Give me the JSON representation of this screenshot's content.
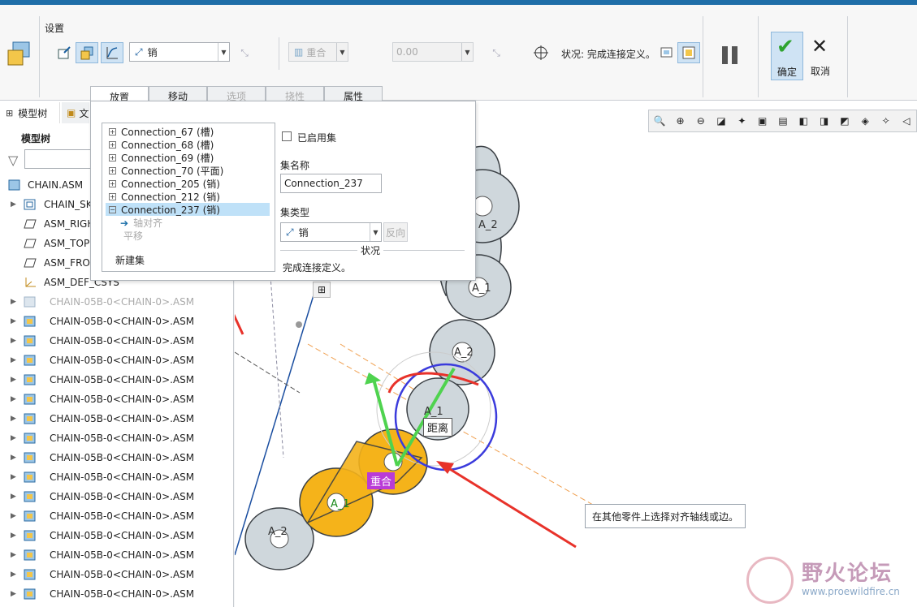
{
  "ribbon": {
    "group_label": "设置",
    "constraint_type": "销",
    "coincident_label": "重合",
    "offset_value": "0.00",
    "status_text": "状况: 完成连接定义。",
    "ok_label": "确定",
    "cancel_label": "取消"
  },
  "tabs": [
    {
      "label": "放置",
      "state": "active"
    },
    {
      "label": "移动",
      "state": "normal"
    },
    {
      "label": "选项",
      "state": "disabled"
    },
    {
      "label": "挠性",
      "state": "disabled"
    },
    {
      "label": "属性",
      "state": "normal"
    }
  ],
  "tree_tabs": {
    "model_tree": "模型树",
    "files": "文"
  },
  "tree": {
    "header": "模型树",
    "items": [
      {
        "label": "CHAIN.ASM",
        "type": "asm-root",
        "expand": false
      },
      {
        "label": "CHAIN_SK",
        "type": "skeleton",
        "expand": true
      },
      {
        "label": "ASM_RIGH",
        "type": "plane",
        "expand": false
      },
      {
        "label": "ASM_TOP",
        "type": "plane",
        "expand": false
      },
      {
        "label": "ASM_FRO",
        "type": "plane",
        "expand": false
      },
      {
        "label": "ASM_DEF_CSYS",
        "type": "csys",
        "expand": false
      },
      {
        "label": "CHAIN-05B-0<CHAIN-0>.ASM",
        "type": "sub-dim",
        "expand": true
      },
      {
        "label": "CHAIN-05B-0<CHAIN-0>.ASM",
        "type": "sub",
        "expand": true
      },
      {
        "label": "CHAIN-05B-0<CHAIN-0>.ASM",
        "type": "sub",
        "expand": true
      },
      {
        "label": "CHAIN-05B-0<CHAIN-0>.ASM",
        "type": "sub",
        "expand": true
      },
      {
        "label": "CHAIN-05B-0<CHAIN-0>.ASM",
        "type": "sub",
        "expand": true
      },
      {
        "label": "CHAIN-05B-0<CHAIN-0>.ASM",
        "type": "sub",
        "expand": true
      },
      {
        "label": "CHAIN-05B-0<CHAIN-0>.ASM",
        "type": "sub",
        "expand": true
      },
      {
        "label": "CHAIN-05B-0<CHAIN-0>.ASM",
        "type": "sub",
        "expand": true
      },
      {
        "label": "CHAIN-05B-0<CHAIN-0>.ASM",
        "type": "sub",
        "expand": true
      },
      {
        "label": "CHAIN-05B-0<CHAIN-0>.ASM",
        "type": "sub",
        "expand": true
      },
      {
        "label": "CHAIN-05B-0<CHAIN-0>.ASM",
        "type": "sub",
        "expand": true
      },
      {
        "label": "CHAIN-05B-0<CHAIN-0>.ASM",
        "type": "sub",
        "expand": true
      },
      {
        "label": "CHAIN-05B-0<CHAIN-0>.ASM",
        "type": "sub",
        "expand": true
      },
      {
        "label": "CHAIN-05B-0<CHAIN-0>.ASM",
        "type": "sub",
        "expand": true
      },
      {
        "label": "CHAIN-05B-0<CHAIN-0>.ASM",
        "type": "sub",
        "expand": true
      },
      {
        "label": "CHAIN-05B-0<CHAIN-0>.ASM",
        "type": "sub",
        "expand": true
      }
    ]
  },
  "placement_panel": {
    "connections": [
      {
        "label": "Connection_67 (槽)",
        "selected": false
      },
      {
        "label": "Connection_68 (槽)",
        "selected": false
      },
      {
        "label": "Connection_69 (槽)",
        "selected": false
      },
      {
        "label": "Connection_70 (平面)",
        "selected": false
      },
      {
        "label": "Connection_205 (销)",
        "selected": false
      },
      {
        "label": "Connection_212 (销)",
        "selected": false
      },
      {
        "label": "Connection_237 (销)",
        "selected": true
      }
    ],
    "sub_items": [
      "轴对齐",
      "平移"
    ],
    "new_set": "新建集",
    "enabled_set_label": "已启用集",
    "set_name_label": "集名称",
    "set_name_value": "Connection_237",
    "set_type_label": "集类型",
    "set_type_value": "销",
    "flip_label": "反向",
    "status_header": "状况",
    "status_value": "完成连接定义。"
  },
  "graphics": {
    "labels": [
      "A_2",
      "A_1",
      "A_2",
      "A_1",
      "A_1",
      "A_2"
    ],
    "distance_tag": "距离",
    "coincident_tag": "重合",
    "hint": "在其他零件上选择对齐轴线或边。",
    "watermark_title": "野火论坛",
    "watermark_url": "www.proewildfire.cn"
  },
  "colors": {
    "accent": "#1f6ea8",
    "chain_gray": "#cfd7dc",
    "chain_orange": "#f5b31a",
    "arrow_red": "#e8322a"
  }
}
